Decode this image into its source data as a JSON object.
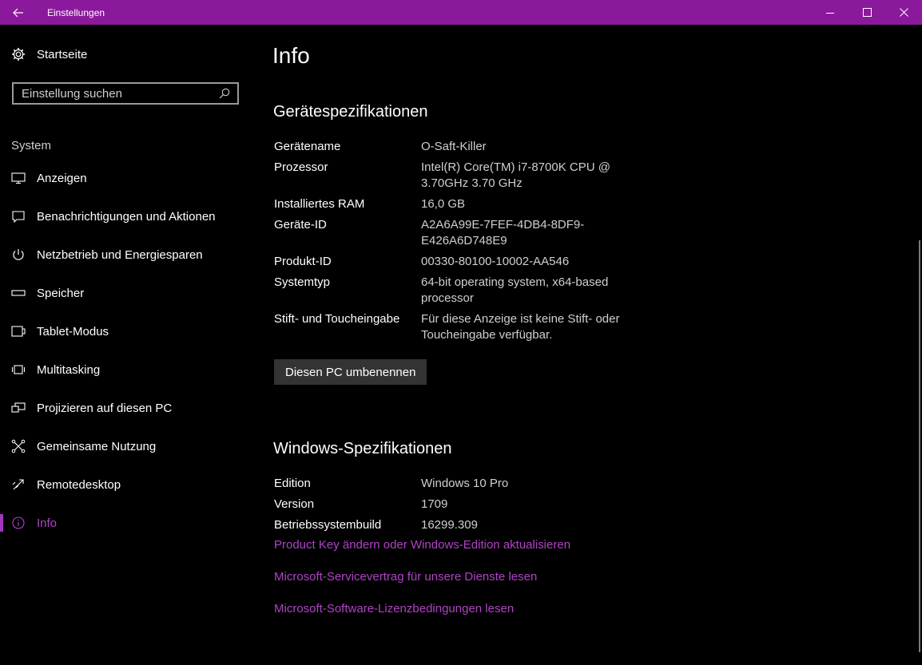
{
  "titlebar": {
    "title": "Einstellungen",
    "accent": "#8b199b"
  },
  "sidebar": {
    "home_label": "Startseite",
    "search_placeholder": "Einstellung suchen",
    "section_label": "System",
    "items": [
      {
        "label": "Anzeigen",
        "icon": "monitor-icon"
      },
      {
        "label": "Benachrichtigungen und Aktionen",
        "icon": "notification-icon"
      },
      {
        "label": "Netzbetrieb und Energiesparen",
        "icon": "power-icon"
      },
      {
        "label": "Speicher",
        "icon": "storage-icon"
      },
      {
        "label": "Tablet-Modus",
        "icon": "tablet-icon"
      },
      {
        "label": "Multitasking",
        "icon": "multitasking-icon"
      },
      {
        "label": "Projizieren auf diesen PC",
        "icon": "project-icon"
      },
      {
        "label": "Gemeinsame Nutzung",
        "icon": "share-icon"
      },
      {
        "label": "Remotedesktop",
        "icon": "remote-icon"
      },
      {
        "label": "Info",
        "icon": "info-icon",
        "active": true
      }
    ]
  },
  "main": {
    "title": "Info",
    "device_heading": "Gerätespezifikationen",
    "device_specs": [
      {
        "key": "Gerätename",
        "value": "O-Saft-Killer"
      },
      {
        "key": "Prozessor",
        "value": "Intel(R) Core(TM) i7-8700K CPU @ 3.70GHz   3.70 GHz"
      },
      {
        "key": "Installiertes RAM",
        "value": "16,0 GB"
      },
      {
        "key": "Geräte-ID",
        "value": "A2A6A99E-7FEF-4DB4-8DF9-E426A6D748E9"
      },
      {
        "key": "Produkt-ID",
        "value": "00330-80100-10002-AA546"
      },
      {
        "key": "Systemtyp",
        "value": "64-bit operating system, x64-based processor"
      },
      {
        "key": "Stift- und Toucheingabe",
        "value": "Für diese Anzeige ist keine Stift- oder Toucheingabe verfügbar."
      }
    ],
    "rename_button": "Diesen PC umbenennen",
    "windows_heading": "Windows-Spezifikationen",
    "windows_specs": [
      {
        "key": "Edition",
        "value": "Windows 10 Pro"
      },
      {
        "key": "Version",
        "value": "1709"
      },
      {
        "key": "Betriebssystembuild",
        "value": "16299.309"
      }
    ],
    "links": [
      "Product Key ändern oder Windows-Edition aktualisieren",
      "Microsoft-Servicevertrag für unsere Dienste lesen",
      "Microsoft-Software-Lizenzbedingungen lesen"
    ],
    "link_color": "#b043c6"
  }
}
